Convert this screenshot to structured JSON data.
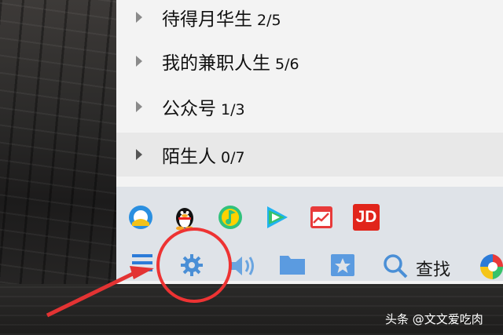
{
  "groups": [
    {
      "name": "待得月华生",
      "count": "2/5"
    },
    {
      "name": "我的兼职人生",
      "count": "5/6"
    },
    {
      "name": "公众号",
      "count": "1/3"
    },
    {
      "name": "陌生人",
      "count": "0/7"
    }
  ],
  "apps": [
    "browser-icon",
    "qq-penguin-icon",
    "qq-music-icon",
    "tencent-video-icon",
    "qq-stock-icon",
    "jd-icon"
  ],
  "apps_jd_label": "JD",
  "toolbar": {
    "menu_icon": "menu-icon",
    "settings_icon": "gear-icon",
    "sound_icon": "speaker-icon",
    "folder_icon": "folder-icon",
    "favorites_icon": "star-icon",
    "find_label": "查找",
    "apps_icon": "app-manager-icon"
  },
  "annotation": {
    "color": "#e33333"
  },
  "watermark": "头条 @文文爱吃肉"
}
